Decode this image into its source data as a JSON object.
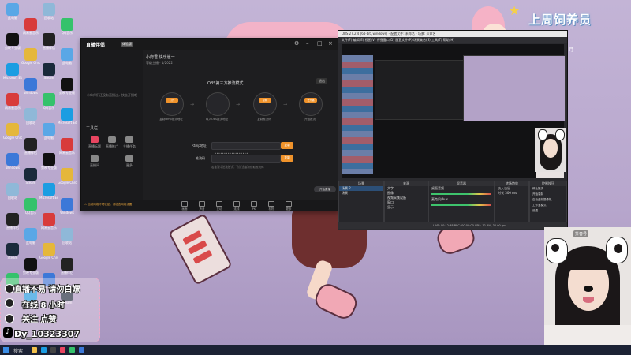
{
  "desktop_icons": [
    {
      "label": "此电脑",
      "color": "#5aa7e6"
    },
    {
      "label": "剪映专业版",
      "color": "#111111"
    },
    {
      "label": "Microsoft Edge",
      "color": "#1b9de2"
    },
    {
      "label": "网易云音乐",
      "color": "#d83b3b"
    },
    {
      "label": "Google Chrome",
      "color": "#e5b73b"
    },
    {
      "label": "Windows",
      "color": "#3c78d8"
    },
    {
      "label": "回收站",
      "color": "#8fb8d8"
    },
    {
      "label": "直播伴侣",
      "color": "#222222"
    },
    {
      "label": "Steam",
      "color": "#1a2a3b"
    },
    {
      "label": "QQ音乐",
      "color": "#35c26b"
    }
  ],
  "banner": {
    "title": "上周饲养员",
    "subtitle": "三 三",
    "date": "上周19号 6 月"
  },
  "streaming_app": {
    "logo": "直播伴侣",
    "badge": "体验版",
    "account": "小府君 快乐崽一",
    "account_meta": "等级主播 · 1/2022",
    "sidebar_tip": "小伙伴们还没有直播过，快去开播吧",
    "tools_heading": "工具栏",
    "tools": [
      "直播标题",
      "直播推广",
      "主播任务",
      "直播间",
      "更多"
    ],
    "mode_title": "OBS第三方推流模式",
    "close_label": "退出",
    "steps": [
      {
        "btn": "打开",
        "label": "复制rtmp推流地址"
      },
      {
        "btn": "",
        "label": "填入OBS推流地址"
      },
      {
        "btn": "复制",
        "label": "复制推流码"
      },
      {
        "btn": "去开播",
        "label": "开始推流"
      }
    ],
    "rtmp_label": "Rtmp地址",
    "rtmp_value": "••••••••••••••••••",
    "key_label": "推流码",
    "key_value": "••••••••••••••••••",
    "copy_label": "复制",
    "hint": "若推流中出现断流，可点击重新获取推流码",
    "bottom_items": [
      "画面",
      "声音",
      "互动",
      "连线",
      "PK",
      "礼物",
      "更多"
    ],
    "start_label": "开始直播",
    "warning": "⚠ 当前网络环境较差，请检查网络设置"
  },
  "obs": {
    "title": "OBS 27.2.4 (64-bit, windows) - 配置文件: 未命名 - 场景: 未命名",
    "menu": "文件(F)  编辑(E)  视图(V)  停靠窗口(D)  配置文件(P)  场景集合(S)  工具(T)  帮助(H)",
    "panel_titles": [
      "场景",
      "来源",
      "混音器",
      "转场特效",
      "控制按钮"
    ],
    "scenes": [
      "场景 2",
      "场景"
    ],
    "sources": [
      "文字",
      "图像",
      "视频采集设备",
      "窗口",
      "显示"
    ],
    "mixer": [
      "桌面音频",
      "麦克风/Aux"
    ],
    "transition": [
      "淡入淡出",
      "时长 300 ms"
    ],
    "controls": [
      "停止推流",
      "开始录制",
      "启动虚拟摄像机",
      "工作室模式",
      "设置",
      "退出"
    ],
    "status": "LIVE: 00:12:38  REC: 00:00:00  CPU: 12.3%, 30.00 fps"
  },
  "webcam": {
    "tag": "抖音号"
  },
  "overlay": {
    "line1": "直播不易 请勿白嫖",
    "line2": "在线 8 小时",
    "line3": "关注 点赞",
    "id": "Dy_10323307"
  },
  "taskbar": {
    "search": "搜索"
  }
}
